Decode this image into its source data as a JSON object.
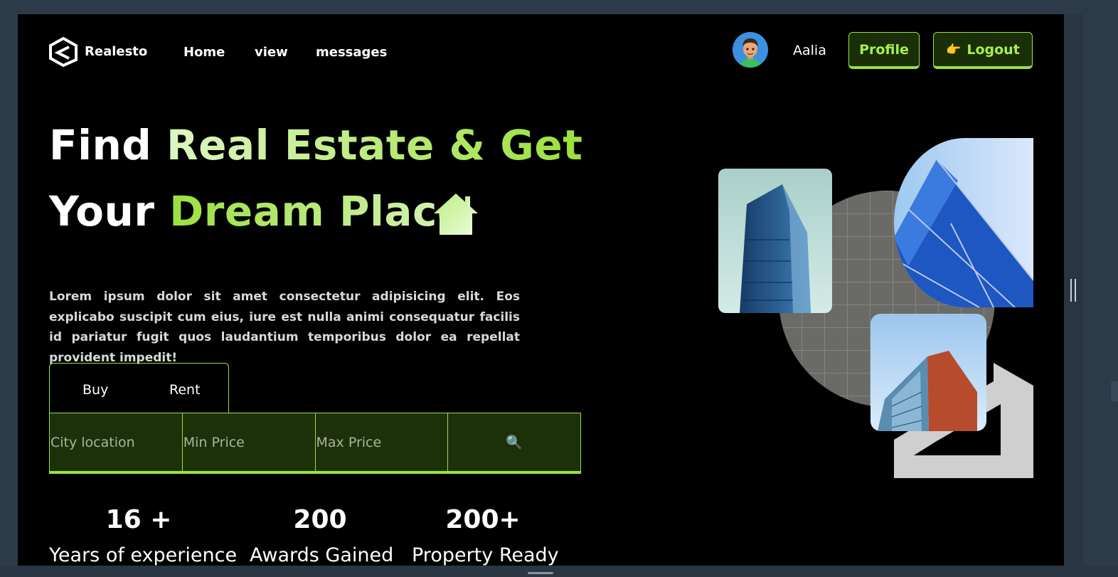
{
  "brand": {
    "name": "Realesto",
    "logo_icon": "realesto-logo-icon"
  },
  "nav": {
    "links": [
      "Home",
      "view",
      "messages"
    ]
  },
  "user": {
    "name": "Aalia",
    "avatar_icon": "user-avatar-icon"
  },
  "buttons": {
    "profile": "Profile",
    "logout": "Logout",
    "logout_emoji": "👉"
  },
  "hero": {
    "line1_white": "Find ",
    "line1_green": "Real Estate & Get",
    "line2_white": "Your ",
    "line2_green": "Dream Place",
    "house_icon": "house-icon",
    "description": "Lorem ipsum dolor sit amet consectetur adipisicing elit. Eos explicabo suscipit cum eius, iure est nulla animi consequatur facilis id pariatur fugit quos laudantium temporibus dolor ea repellat provident impedit!"
  },
  "search": {
    "tabs": [
      "Buy",
      "Rent"
    ],
    "city_placeholder": "City location",
    "min_placeholder": "Min Price",
    "max_placeholder": "Max Price",
    "search_icon": "magnifier-icon",
    "search_glyph": "🔍"
  },
  "stats": [
    {
      "value": "16 +",
      "label": "Years of experience"
    },
    {
      "value": "200",
      "label": "Awards Gained"
    },
    {
      "value": "200+",
      "label": "Property Ready"
    }
  ],
  "colors": {
    "accent": "#9be03c",
    "accent_dark": "#1c300a",
    "background": "#000000"
  }
}
